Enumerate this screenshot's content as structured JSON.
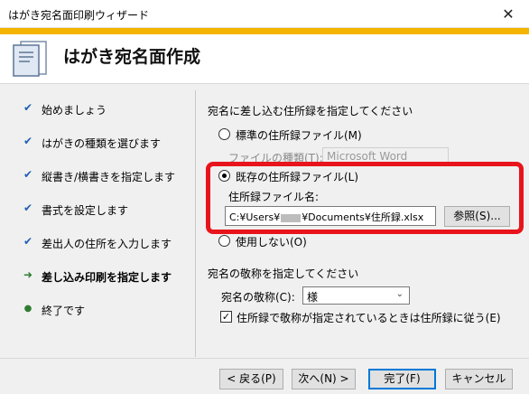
{
  "window": {
    "title": "はがき宛名面印刷ウィザード",
    "close_glyph": "✕"
  },
  "header": {
    "title": "はがき宛名面作成"
  },
  "steps": [
    {
      "label": "始めましょう",
      "mark": "✔"
    },
    {
      "label": "はがきの種類を選びます",
      "mark": "✔"
    },
    {
      "label": "縦書き/横書きを指定します",
      "mark": "✔"
    },
    {
      "label": "書式を設定します",
      "mark": "✔"
    },
    {
      "label": "差出人の住所を入力します",
      "mark": "✔"
    },
    {
      "label": "差し込み印刷を指定します",
      "mark": "➜"
    },
    {
      "label": "終了です",
      "mark": "●"
    }
  ],
  "address_section": {
    "heading": "宛名に差し込む住所録を指定してください",
    "standard_radio_label": "標準の住所録ファイル(M)",
    "file_type_label": "ファイルの種類(T):",
    "file_type_value": "Microsoft Word",
    "existing_radio_label": "既存の住所録ファイル(L)",
    "file_name_label": "住所録ファイル名:",
    "file_path_prefix": "C:¥Users¥",
    "file_path_suffix": "¥Documents¥住所録.xlsx",
    "browse_label": "参照(S)...",
    "no_use_radio_label": "使用しない(O)"
  },
  "honorific_section": {
    "heading": "宛名の敬称を指定してください",
    "honorific_label": "宛名の敬称(C):",
    "honorific_value": "様",
    "checkbox_label": "住所録で敬称が指定されているときは住所録に従う(E)",
    "checkbox_checked": true
  },
  "footer": {
    "back_label": "< 戻る(P)",
    "next_label": "次へ(N) >",
    "finish_label": "完了(F)",
    "cancel_label": "キャンセル"
  },
  "colors": {
    "highlight": "#e8141c",
    "header_stripe": "#f4b400",
    "default_button_border": "#0078d7"
  }
}
